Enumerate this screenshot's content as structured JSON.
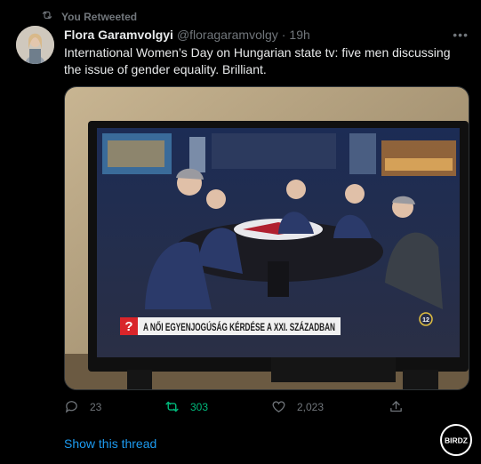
{
  "retweet": {
    "label": "You Retweeted"
  },
  "tweet": {
    "author_name": "Flora Garamvolgyi",
    "handle": "@floragaramvolgy",
    "separator": "·",
    "time": "19h",
    "more": "•••",
    "text": "International Women’s Day on Hungarian state tv: five men discussing the issue of gender equality. Brilliant."
  },
  "media": {
    "chyron_text": "A NŐI EGYENJOGÚSÁG KÉRDÉSE A XXI. SZÁZADBAN",
    "chyron_mark": "?",
    "channel_badge": "12"
  },
  "actions": {
    "reply_count": "23",
    "retweet_count": "303",
    "like_count": "2,023"
  },
  "thread": {
    "show_label": "Show this thread"
  },
  "watermark": {
    "label": "BIRDZ"
  },
  "colors": {
    "background": "#000000",
    "text": "#e7e9ea",
    "muted": "#71767b",
    "link": "#1d9bf0",
    "retweet": "#00ba7c"
  }
}
